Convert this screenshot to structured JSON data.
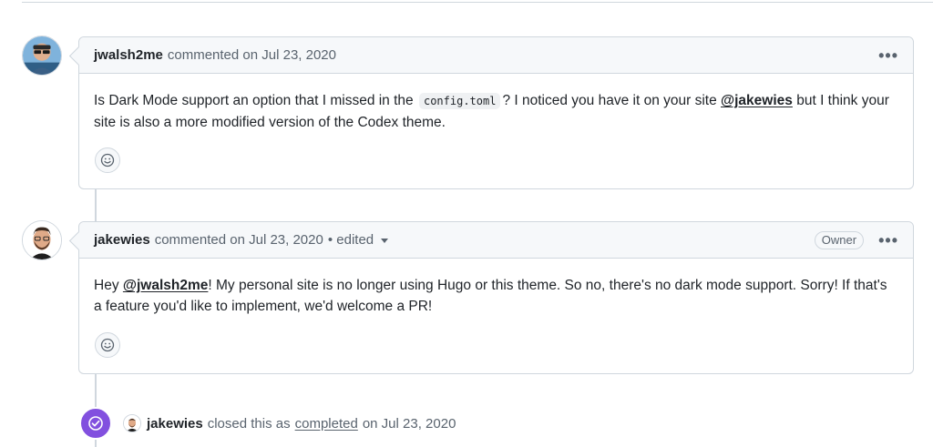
{
  "comments": [
    {
      "author": "jwalsh2me",
      "meta": "commented on Jul 23, 2020",
      "edited": "",
      "badge": "",
      "text_before": "Is Dark Mode support an option that I missed in the",
      "code": "config.toml",
      "text_mid": "? I noticed you have it on your site",
      "mention": "@jakewies",
      "text_after": "but I think your site is also a more modified version of the Codex theme."
    },
    {
      "author": "jakewies",
      "meta": "commented on Jul 23, 2020",
      "edited": "• edited",
      "badge": "Owner",
      "text_before": "Hey",
      "mention": "@jwalsh2me",
      "text_after": "! My personal site is no longer using Hugo or this theme. So no, there's no dark mode support. Sorry! If that's a feature you'd like to implement, we'd welcome a PR!"
    }
  ],
  "event": {
    "author": "jakewies",
    "prefix": "closed this as",
    "link": "completed",
    "suffix": "on Jul 23, 2020"
  },
  "icons": {
    "kebab": "kebab-horizontal-icon",
    "reaction": "smiley-icon",
    "closed": "check-circle-icon",
    "caret": "triangle-down-icon"
  },
  "colors": {
    "border": "#d0d7de",
    "header_bg": "#f6f8fa",
    "closed_purple": "#8250df",
    "muted_text": "#59636e"
  }
}
